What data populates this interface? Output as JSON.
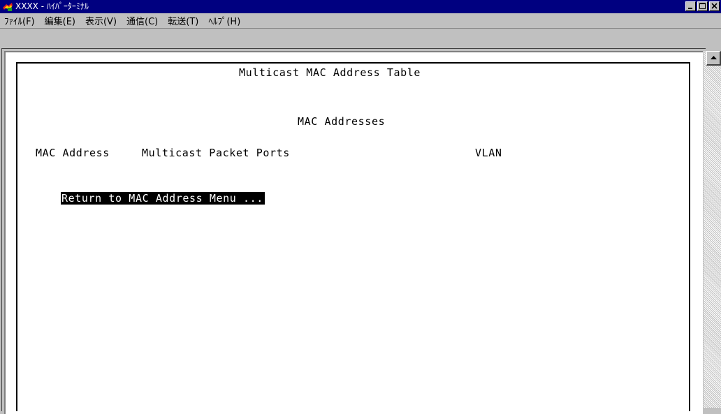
{
  "window": {
    "title": "XXXX - ﾊｲﾊﾟｰﾀｰﾐﾅﾙ",
    "icon": "hyperterminal-icon",
    "controls": [
      "minimize-icon",
      "maximize-icon",
      "close-icon"
    ]
  },
  "menubar": {
    "items": [
      {
        "label": "ﾌｧｲﾙ(F)"
      },
      {
        "label": "編集(E)"
      },
      {
        "label": "表示(V)"
      },
      {
        "label": "通信(C)"
      },
      {
        "label": "転送(T)"
      },
      {
        "label": "ﾍﾙﾌﾟ(H)"
      }
    ]
  },
  "terminal": {
    "title": "Multicast MAC Address Table",
    "subtitle": "MAC Addresses",
    "columns": [
      "MAC Address",
      "Multicast Packet Ports",
      "VLAN"
    ],
    "return_option": "Return to MAC Address Menu ..."
  },
  "colors": {
    "titlebar": "#000080",
    "chrome": "#c0c0c0",
    "terminal_bg": "#ffffff",
    "highlight": "#000000"
  }
}
